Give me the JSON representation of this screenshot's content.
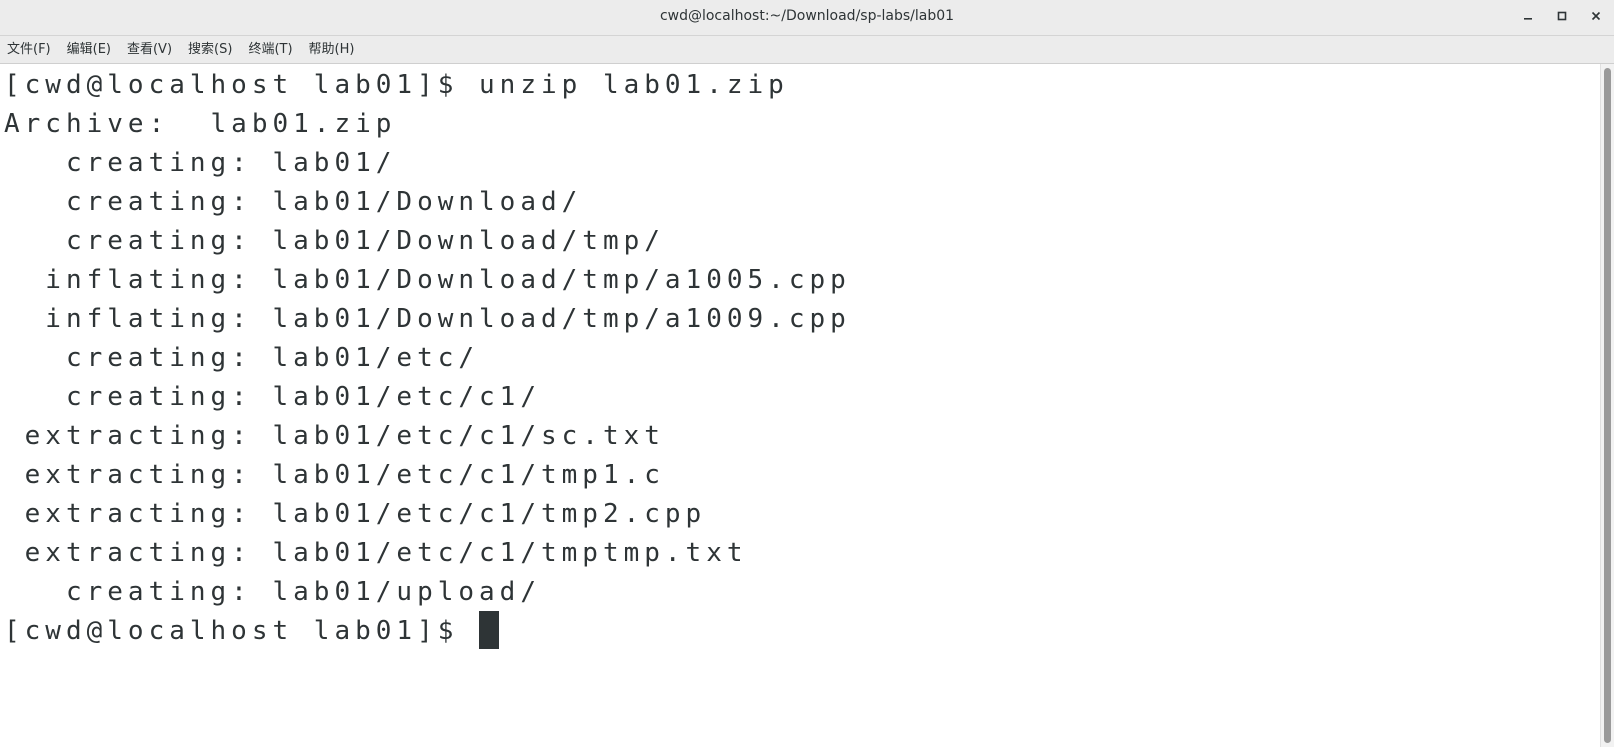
{
  "window": {
    "title": "cwd@localhost:~/Download/sp-labs/lab01",
    "buttons": {
      "minimize": "−",
      "maximize": "□",
      "close": "✕"
    }
  },
  "menu": [
    {
      "label": "文件(F)"
    },
    {
      "label": "编辑(E)"
    },
    {
      "label": "查看(V)"
    },
    {
      "label": "搜索(S)"
    },
    {
      "label": "终端(T)"
    },
    {
      "label": "帮助(H)"
    }
  ],
  "terminal": {
    "lines": [
      "[cwd@localhost lab01]$ unzip lab01.zip",
      "Archive:  lab01.zip",
      "   creating: lab01/",
      "   creating: lab01/Download/",
      "   creating: lab01/Download/tmp/",
      "  inflating: lab01/Download/tmp/a1005.cpp",
      "  inflating: lab01/Download/tmp/a1009.cpp",
      "   creating: lab01/etc/",
      "   creating: lab01/etc/c1/",
      " extracting: lab01/etc/c1/sc.txt",
      " extracting: lab01/etc/c1/tmp1.c",
      " extracting: lab01/etc/c1/tmp2.cpp",
      " extracting: lab01/etc/c1/tmptmp.txt",
      "   creating: lab01/upload/"
    ],
    "prompt": "[cwd@localhost lab01]$ "
  }
}
